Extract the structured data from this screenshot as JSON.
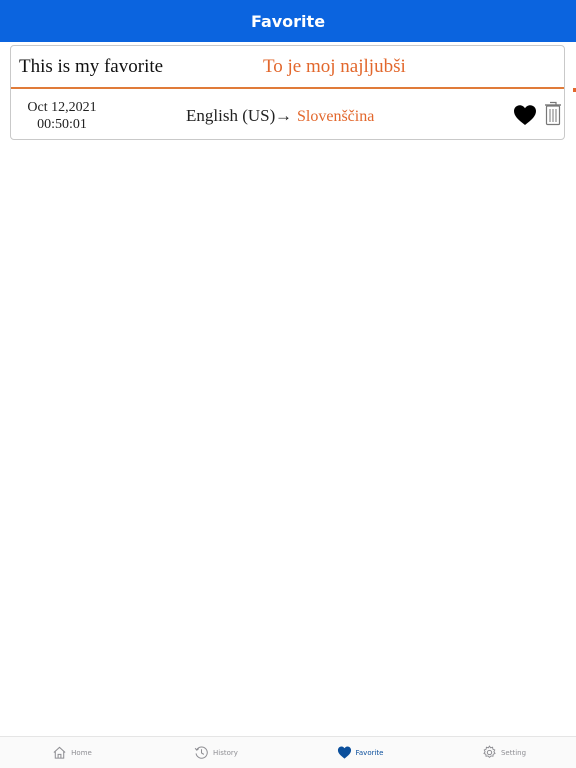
{
  "nav": {
    "title": "Favorite"
  },
  "colors": {
    "accent": "#0b64df",
    "target_text": "#e2672c",
    "active_tab": "#0b4f9c"
  },
  "favorites": [
    {
      "source_text": "This is my favorite",
      "translated_text": "To je moj najljubši",
      "date": "Oct 12,2021",
      "time": "00:50:01",
      "from_lang": "English (US)",
      "arrow": "→",
      "to_lang": "Slovenščina",
      "icons": [
        "heart-icon",
        "trash-icon"
      ]
    }
  ],
  "tabs": [
    {
      "label": "Home",
      "icon": "home-icon",
      "active": false
    },
    {
      "label": "History",
      "icon": "history-icon",
      "active": false
    },
    {
      "label": "Favorite",
      "icon": "heart-icon",
      "active": true
    },
    {
      "label": "Setting",
      "icon": "gear-icon",
      "active": false
    }
  ]
}
